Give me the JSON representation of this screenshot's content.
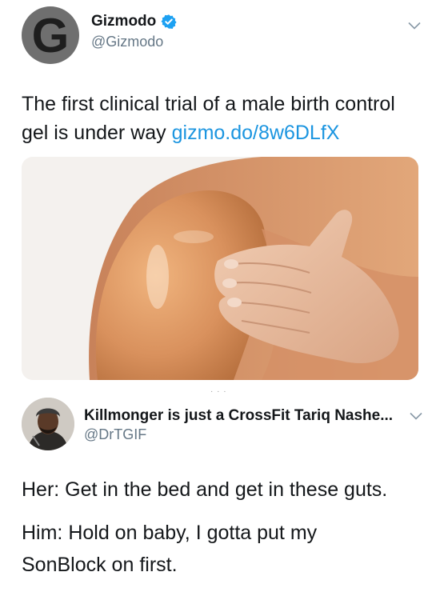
{
  "tweet": {
    "avatar_letter": "G",
    "display_name": "Gizmodo",
    "verified": true,
    "handle": "@Gizmodo",
    "text": "The first clinical trial of a male birth control gel is under way ",
    "link": "gizmo.do/8w6DLfX",
    "media_alt_icon": "shoulder-photo"
  },
  "quote": {
    "display_name": "Killmonger is just a CrossFit Tariq Nashe...",
    "handle": "@DrTGIF",
    "line1": "Her: Get in the bed and get in these guts.",
    "line2": "Him: Hold on baby, I gotta put my",
    "line3": "SonBlock on first."
  },
  "colors": {
    "link": "#1b95e0",
    "verified": "#1da1f2",
    "handle": "#657786"
  }
}
